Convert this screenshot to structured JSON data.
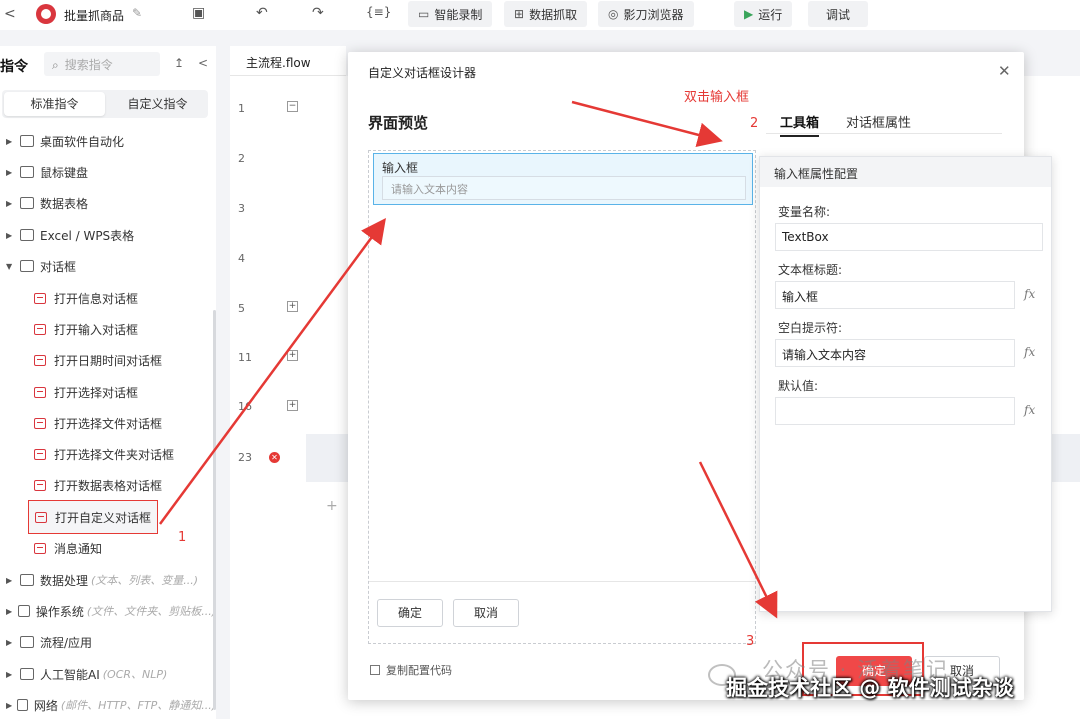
{
  "app": {
    "title": "批量抓商品"
  },
  "toolbar": {
    "smart_record": "智能录制",
    "data_capture": "数据抓取",
    "browser": "影刀浏览器",
    "run": "运行",
    "debug": "调试",
    "var_icon": "{≡}"
  },
  "left": {
    "title": "指令",
    "search_placeholder": "搜索指令",
    "tabs": [
      "标准指令",
      "自定义指令"
    ],
    "groups": [
      {
        "label": "桌面软件自动化",
        "hint": ""
      },
      {
        "label": "鼠标键盘",
        "hint": ""
      },
      {
        "label": "数据表格",
        "hint": ""
      },
      {
        "label": "Excel / WPS表格",
        "hint": ""
      },
      {
        "label": "对话框",
        "hint": ""
      }
    ],
    "dialog_items": [
      "打开信息对话框",
      "打开输入对话框",
      "打开日期时间对话框",
      "打开选择对话框",
      "打开选择文件对话框",
      "打开选择文件夹对话框",
      "打开数据表格对话框",
      "打开自定义对话框",
      "消息通知"
    ],
    "groups_after": [
      {
        "label": "数据处理",
        "hint": "(文本、列表、变量...)"
      },
      {
        "label": "操作系统",
        "hint": "(文件、文件夹、剪贴板...)"
      },
      {
        "label": "流程/应用",
        "hint": ""
      },
      {
        "label": "人工智能AI",
        "hint": "(OCR、NLP)"
      },
      {
        "label": "网络",
        "hint": "(邮件、HTTP、FTP、静通知...)"
      }
    ]
  },
  "editor": {
    "tab": "主流程.flow",
    "line_numbers": [
      "1",
      "2",
      "3",
      "4",
      "5",
      "11",
      "16",
      "23"
    ]
  },
  "dialog": {
    "title": "自定义对话框设计器",
    "preview_title": "界面预览",
    "field_label": "输入框",
    "field_placeholder": "请输入文本内容",
    "ok": "确定",
    "cancel": "取消",
    "copy_config": "复制配置代码",
    "right_tabs": [
      "工具箱",
      "对话框属性"
    ],
    "footer_ok": "确定",
    "footer_cancel": "取消"
  },
  "props": {
    "header": "输入框属性配置",
    "var_label": "变量名称:",
    "var_value": "TextBox",
    "title_label": "文本框标题:",
    "title_value": "输入框",
    "placeholder_label": "空白提示符:",
    "placeholder_value": "请输入文本内容",
    "default_label": "默认值:",
    "default_value": "",
    "fx": "fx"
  },
  "annotations": {
    "double_click": "双击输入框",
    "n1": "1",
    "n2": "2",
    "n3": "3",
    "color": "#e53935"
  },
  "watermark": {
    "line1": "公众号 · 活着笔记",
    "line2": "掘金技术社区 @ 软件测试杂谈"
  }
}
